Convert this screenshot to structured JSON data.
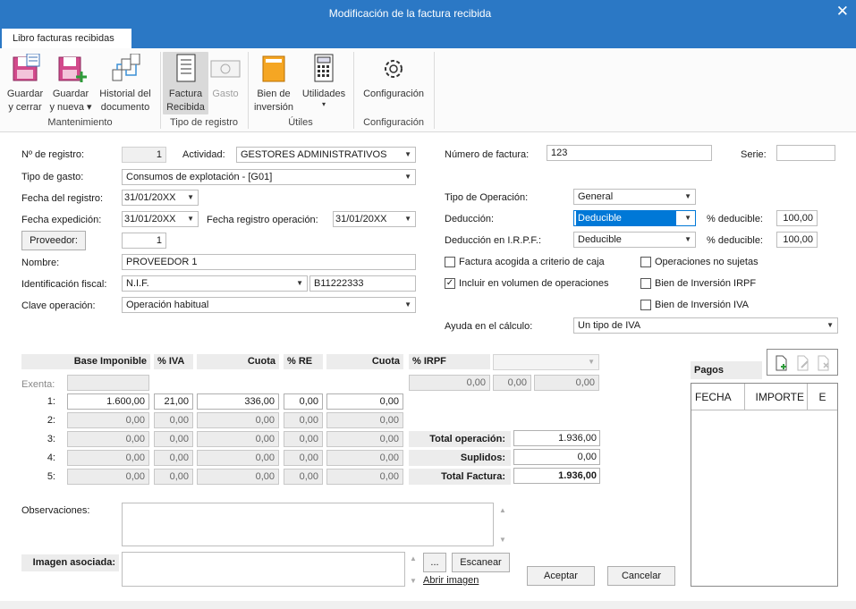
{
  "window": {
    "title": "Modificación de la factura recibida"
  },
  "tab": {
    "label": "Libro facturas recibidas"
  },
  "ribbon": {
    "buttons": {
      "guardar_cerrar": [
        "Guardar",
        "y cerrar"
      ],
      "guardar_nueva": [
        "Guardar",
        "y nueva ▾"
      ],
      "historial": [
        "Historial del",
        "documento"
      ],
      "factura_recibida": [
        "Factura",
        "Recibida"
      ],
      "gasto": "Gasto",
      "bien_inversion": [
        "Bien de",
        "inversión"
      ],
      "utilidades": [
        "Utilidades",
        "▾"
      ],
      "configuracion": "Configuración"
    },
    "groups": {
      "mantenimiento": "Mantenimiento",
      "tipo_registro": "Tipo de registro",
      "utiles": "Útiles",
      "configuracion": "Configuración"
    }
  },
  "form": {
    "n_registro": {
      "label": "Nº de registro:",
      "value": "1"
    },
    "actividad": {
      "label": "Actividad:",
      "value": "GESTORES ADMINISTRATIVOS"
    },
    "tipo_gasto": {
      "label": "Tipo de gasto:",
      "value": "Consumos de explotación - [G01]"
    },
    "fecha_registro": {
      "label": "Fecha del registro:",
      "value": "31/01/20XX"
    },
    "fecha_expedicion": {
      "label": "Fecha expedición:",
      "value": "31/01/20XX"
    },
    "fecha_registro_operacion": {
      "label": "Fecha registro operación:",
      "value": "31/01/20XX"
    },
    "proveedor": {
      "button": "Proveedor:",
      "value": "1"
    },
    "nombre": {
      "label": "Nombre:",
      "value": "PROVEEDOR 1"
    },
    "identificacion": {
      "label": "Identificación fiscal:",
      "type": "N.I.F.",
      "value": "B11222333"
    },
    "clave_operacion": {
      "label": "Clave operación:",
      "value": "Operación habitual"
    },
    "numero_factura": {
      "label": "Número de factura:",
      "value": "123"
    },
    "serie": {
      "label": "Serie:",
      "value": ""
    },
    "tipo_operacion": {
      "label": "Tipo de Operación:",
      "value": "General"
    },
    "deduccion": {
      "label": "Deducción:",
      "value": "Deducible",
      "pct_label": "% deducible:",
      "pct": "100,00"
    },
    "deduccion_irpf": {
      "label": "Deducción en I.R.P.F.:",
      "value": "Deducible",
      "pct_label": "% deducible:",
      "pct": "100,00"
    },
    "checks": {
      "criterio_caja": {
        "label": "Factura acogida a criterio de caja",
        "checked": false
      },
      "no_sujetas": {
        "label": "Operaciones no sujetas",
        "checked": false
      },
      "incluir_volumen": {
        "label": "Incluir en  volumen de operaciones",
        "checked": true
      },
      "bien_irpf": {
        "label": "Bien de Inversión IRPF",
        "checked": false
      },
      "bien_iva": {
        "label": "Bien de Inversión IVA",
        "checked": false
      }
    },
    "ayuda_calculo": {
      "label": "Ayuda en el cálculo:",
      "value": "Un tipo de IVA"
    }
  },
  "table": {
    "headers": {
      "base": "Base Imponible",
      "iva": "% IVA",
      "cuota": "Cuota",
      "re": "% RE",
      "cuota_re": "Cuota",
      "irpf": "% IRPF"
    },
    "exenta_label": "Exenta:",
    "rows": [
      {
        "label": "1:",
        "base": "1.600,00",
        "iva": "21,00",
        "cuota": "336,00",
        "re": "0,00",
        "cuota_re": "0,00"
      },
      {
        "label": "2:",
        "base": "0,00",
        "iva": "0,00",
        "cuota": "0,00",
        "re": "0,00",
        "cuota_re": "0,00"
      },
      {
        "label": "3:",
        "base": "0,00",
        "iva": "0,00",
        "cuota": "0,00",
        "re": "0,00",
        "cuota_re": "0,00"
      },
      {
        "label": "4:",
        "base": "0,00",
        "iva": "0,00",
        "cuota": "0,00",
        "re": "0,00",
        "cuota_re": "0,00"
      },
      {
        "label": "5:",
        "base": "0,00",
        "iva": "0,00",
        "cuota": "0,00",
        "re": "0,00",
        "cuota_re": "0,00"
      }
    ],
    "irpf_values": [
      "0,00",
      "0,00",
      "0,00"
    ],
    "totals": {
      "operacion": {
        "label": "Total operación:",
        "value": "1.936,00"
      },
      "suplidos": {
        "label": "Suplidos:",
        "value": "0,00"
      },
      "factura": {
        "label": "Total Factura:",
        "value": "1.936,00"
      }
    }
  },
  "pagos": {
    "title": "Pagos",
    "columns": [
      "FECHA",
      "IMPORTE",
      "E"
    ]
  },
  "observaciones": {
    "label": "Observaciones:",
    "value": ""
  },
  "imagen": {
    "label": "Imagen asociada:",
    "browse": "...",
    "escanear": "Escanear",
    "abrir": "Abrir imagen"
  },
  "actions": {
    "aceptar": "Aceptar",
    "cancelar": "Cancelar"
  }
}
